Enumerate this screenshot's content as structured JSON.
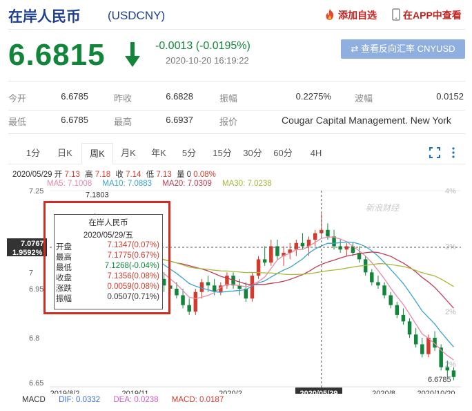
{
  "header": {
    "title": "在岸人民币",
    "code": "(USDCNY)",
    "favorite_label": "添加自选",
    "app_label": "在APP中查看"
  },
  "price": {
    "current": "6.6815",
    "change": "-0.0013 (-0.0195%)",
    "time": "2020-10-20 16:19:22",
    "reverse_button": "查看反向汇率 CNYUSD"
  },
  "quote": {
    "open_label": "今开",
    "open": "6.6785",
    "prev_close_label": "昨收",
    "prev_close": "6.6828",
    "amplitude_label": "振幅",
    "amplitude": "0.2275%",
    "wave_label": "波幅",
    "wave": "0.0152",
    "low_label": "最低",
    "low": "6.6785",
    "high_label": "最高",
    "high": "6.6937",
    "quoter_label": "报价",
    "quoter": "Cougar Capital Management. New York"
  },
  "tabs": [
    "1分",
    "日K",
    "周K",
    "月K",
    "年K",
    "5分",
    "15分",
    "30分",
    "60分",
    "4H"
  ],
  "active_tab": "周K",
  "chart_legend": {
    "date": "2020/05/29",
    "open_label": "开",
    "open": "7.13",
    "high_label": "高",
    "high": "7.18",
    "close_label": "收",
    "close": "7.14",
    "low_label": "低",
    "low": "7.13",
    "vol_label": "量",
    "vol": "0",
    "pct": "0.08%",
    "ma5": "MA5: 7.1008",
    "ma10": "MA10: 7.0883",
    "ma20": "MA20: 7.0309",
    "ma30": "MA30: 7.0238"
  },
  "tooltip": {
    "title": "在岸人民币",
    "date": "2020/05/29/五",
    "rows": [
      {
        "label": "开盘",
        "value": "7.1347(0.07%)",
        "color": "#d23c2e"
      },
      {
        "label": "最高",
        "value": "7.1775(0.67%)",
        "color": "#d23c2e"
      },
      {
        "label": "最低",
        "value": "7.1268(-0.04%)",
        "color": "#11853a"
      },
      {
        "label": "收盘",
        "value": "7.1356(0.08%)",
        "color": "#d23c2e"
      },
      {
        "label": "涨跌",
        "value": "0.0059(0.08%)",
        "color": "#d23c2e"
      },
      {
        "label": "振幅",
        "value": "0.0507(0.71%)",
        "color": "#333333"
      }
    ]
  },
  "watermark": "新浪财经",
  "macd": {
    "label": "MACD",
    "dif": "DIF: 0.0332",
    "dea": "DEA: 0.0238",
    "macd": "MACD: 0.0187"
  },
  "colors": {
    "up": "#d23c2e",
    "down": "#11853a",
    "ma5": "#e88aa6",
    "ma10": "#3aa3cf",
    "ma20": "#c23b55",
    "ma30": "#a8b83a",
    "title_blue": "#1d3f8c"
  },
  "chart_data": {
    "type": "candlestick",
    "x_tick_labels": [
      "2019/8/2",
      "2019/11",
      "2020/2",
      "2020/05/29",
      "2020/8",
      "2020/10/20"
    ],
    "y_tick_labels": [
      "7.25",
      "7",
      "6.95",
      "6.8",
      "6.65"
    ],
    "right_axis_labels": [
      "4%",
      "2%",
      "2%",
      "2%"
    ],
    "crosshair_y_label": "7.0767",
    "crosshair_pct_label": "1.9592%",
    "max_label": "7.1803",
    "min_label": "6.6785",
    "ylim": [
      6.65,
      7.25
    ],
    "candles": [
      [
        6.96,
        6.98,
        6.94,
        6.97
      ],
      [
        6.97,
        7.0,
        6.96,
        6.98
      ],
      [
        6.98,
        7.05,
        6.97,
        7.04
      ],
      [
        7.04,
        7.08,
        7.02,
        7.07
      ],
      [
        7.07,
        7.1,
        7.05,
        7.08
      ],
      [
        7.08,
        7.12,
        7.06,
        7.1
      ],
      [
        7.1,
        7.18,
        7.08,
        7.13
      ],
      [
        7.13,
        7.15,
        7.08,
        7.1
      ],
      [
        7.1,
        7.12,
        7.06,
        7.08
      ],
      [
        7.08,
        7.1,
        7.05,
        7.06
      ],
      [
        7.06,
        7.08,
        7.03,
        7.05
      ],
      [
        7.05,
        7.07,
        7.02,
        7.04
      ],
      [
        7.04,
        7.06,
        7.0,
        7.02
      ],
      [
        7.02,
        7.05,
        7.0,
        7.03
      ],
      [
        7.03,
        7.06,
        7.0,
        7.01
      ],
      [
        7.01,
        7.03,
        6.98,
        7.0
      ],
      [
        7.0,
        7.02,
        6.96,
        6.98
      ],
      [
        6.98,
        7.0,
        6.94,
        6.96
      ],
      [
        6.96,
        6.98,
        6.93,
        6.95
      ],
      [
        6.95,
        6.97,
        6.92,
        6.93
      ],
      [
        6.93,
        6.95,
        6.89,
        6.9
      ],
      [
        6.9,
        6.92,
        6.87,
        6.88
      ],
      [
        6.88,
        6.95,
        6.87,
        6.94
      ],
      [
        6.94,
        6.98,
        6.92,
        6.97
      ],
      [
        6.97,
        6.99,
        6.94,
        6.96
      ],
      [
        6.96,
        6.98,
        6.93,
        6.94
      ],
      [
        6.94,
        6.97,
        6.93,
        6.96
      ],
      [
        6.96,
        7.0,
        6.95,
        6.99
      ],
      [
        6.99,
        7.0,
        6.95,
        6.96
      ],
      [
        6.96,
        6.98,
        6.93,
        6.95
      ],
      [
        6.95,
        6.97,
        6.91,
        6.92
      ],
      [
        6.92,
        7.0,
        6.91,
        6.99
      ],
      [
        6.99,
        7.05,
        6.98,
        7.04
      ],
      [
        7.04,
        7.08,
        7.02,
        7.03
      ],
      [
        7.03,
        7.1,
        7.02,
        7.08
      ],
      [
        7.08,
        7.1,
        7.04,
        7.05
      ],
      [
        7.05,
        7.08,
        7.02,
        7.06
      ],
      [
        7.06,
        7.09,
        7.04,
        7.07
      ],
      [
        7.07,
        7.1,
        7.05,
        7.09
      ],
      [
        7.09,
        7.12,
        7.07,
        7.08
      ],
      [
        7.08,
        7.11,
        7.05,
        7.1
      ],
      [
        7.1,
        7.13,
        7.08,
        7.12
      ],
      [
        7.12,
        7.18,
        7.11,
        7.13
      ],
      [
        7.13,
        7.15,
        7.1,
        7.11
      ],
      [
        7.11,
        7.13,
        7.07,
        7.08
      ],
      [
        7.08,
        7.1,
        7.06,
        7.07
      ],
      [
        7.07,
        7.09,
        7.05,
        7.08
      ],
      [
        7.08,
        7.09,
        7.05,
        7.06
      ],
      [
        7.06,
        7.08,
        7.03,
        7.04
      ],
      [
        7.04,
        7.05,
        6.99,
        7.0
      ],
      [
        7.0,
        7.01,
        6.96,
        6.97
      ],
      [
        6.97,
        6.99,
        6.95,
        6.96
      ],
      [
        6.96,
        6.97,
        6.92,
        6.93
      ],
      [
        6.93,
        6.94,
        6.89,
        6.9
      ],
      [
        6.9,
        6.91,
        6.86,
        6.87
      ],
      [
        6.87,
        6.89,
        6.84,
        6.85
      ],
      [
        6.85,
        6.86,
        6.8,
        6.81
      ],
      [
        6.81,
        6.83,
        6.77,
        6.78
      ],
      [
        6.78,
        6.8,
        6.74,
        6.75
      ],
      [
        6.75,
        6.81,
        6.74,
        6.8
      ],
      [
        6.8,
        6.82,
        6.76,
        6.77
      ],
      [
        6.77,
        6.78,
        6.7,
        6.71
      ],
      [
        6.71,
        6.73,
        6.68,
        6.7
      ],
      [
        6.7,
        6.71,
        6.67,
        6.68
      ]
    ]
  }
}
